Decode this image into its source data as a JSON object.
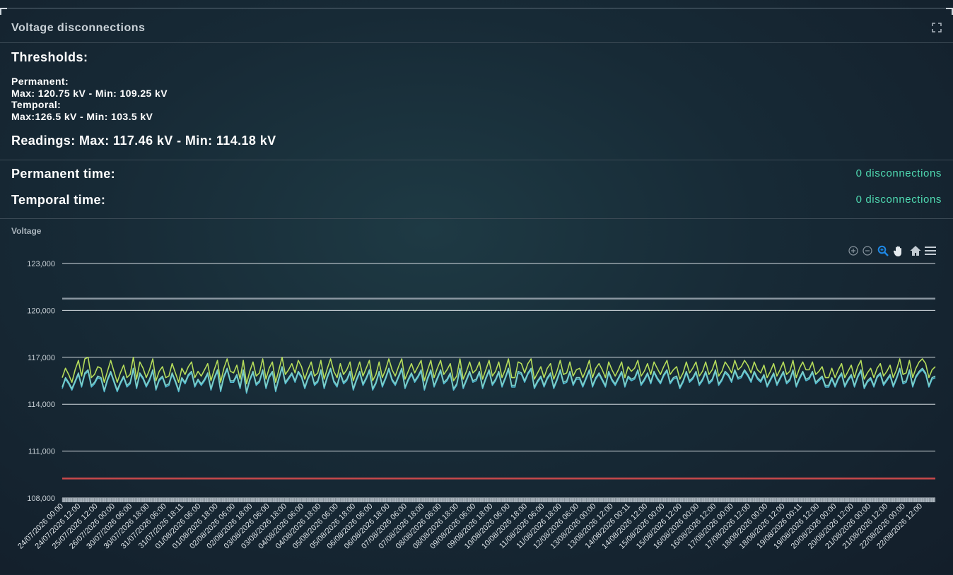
{
  "panel": {
    "title": "Voltage disconnections",
    "expand_icon": "fullscreen-icon"
  },
  "thresholds": {
    "heading": "Thresholds:",
    "permanent_label": "Permanent:",
    "permanent_range": "Max: 120.75 kV - Min: 109.25 kV",
    "temporal_label": "Temporal:",
    "temporal_range": "Max:126.5 kV - Min: 103.5 kV",
    "readings": "Readings: Max: 117.46 kV - Min: 114.18 kV"
  },
  "disconnections": {
    "permanent_label": "Permanent time:",
    "permanent_value": "0 disconnections",
    "temporal_label": "Temporal time:",
    "temporal_value": "0 disconnections"
  },
  "toolbar": [
    "zoom-in-icon",
    "zoom-out-icon",
    "selection-zoom-icon",
    "pan-hand-icon",
    "home-reset-icon",
    "menu-icon"
  ],
  "colors": {
    "accent": "#4fd8b0",
    "series_1": "#b5dc5a",
    "series_2": "#4fb8d2",
    "series_3": "#7ed0c8",
    "max_threshold": "#8a96a0",
    "min_threshold": "#c9494b"
  },
  "chart_data": {
    "type": "line",
    "title": "Voltage",
    "ylim": [
      108000,
      123000
    ],
    "yticks": [
      123000,
      120000,
      117000,
      114000,
      111000,
      108000
    ],
    "ytick_labels": [
      "123,000",
      "120,000",
      "117,000",
      "114,000",
      "111,000",
      "108,000"
    ],
    "x_tick_labels": [
      "24/07/2026 00:00",
      "24/07/2026 12:00",
      "25/07/2026 12:00",
      "26/07/2026 00:00",
      "30/07/2026 06:00",
      "30/07/2026 18:00",
      "31/07/2026 06:00",
      "31/07/2026 18:11",
      "01/08/2026 06:00",
      "01/08/2026 18:00",
      "02/08/2026 06:00",
      "02/08/2026 18:00",
      "03/08/2026 06:00",
      "03/08/2026 18:00",
      "04/08/2026 06:00",
      "04/08/2026 18:00",
      "05/08/2026 06:00",
      "05/08/2026 18:00",
      "06/08/2026 06:00",
      "06/08/2026 18:00",
      "07/08/2026 06:00",
      "07/08/2026 18:00",
      "08/08/2026 06:00",
      "08/08/2026 18:00",
      "09/08/2026 06:00",
      "09/08/2026 18:00",
      "10/08/2026 06:00",
      "10/08/2026 18:00",
      "11/08/2026 06:00",
      "11/08/2026 18:00",
      "12/08/2026 06:00",
      "13/08/2026 00:00",
      "13/08/2026 12:00",
      "14/08/2026 00:11",
      "14/08/2026 12:00",
      "15/08/2026 00:00",
      "15/08/2026 12:00",
      "16/08/2026 00:00",
      "16/08/2026 12:00",
      "17/08/2026 00:00",
      "17/08/2026 12:00",
      "18/08/2026 00:00",
      "18/08/2026 12:00",
      "19/08/2026 00:11",
      "19/08/2026 12:00",
      "20/08/2026 00:00",
      "20/08/2026 12:00",
      "21/08/2026 00:00",
      "21/08/2026 12:00",
      "22/08/2026 00:00",
      "22/08/2026 12:00"
    ],
    "thresholds": [
      {
        "value": 120750
      },
      {
        "value": 109250
      }
    ],
    "series": [
      {
        "values": [
          115700,
          116300,
          115900,
          115400,
          116200,
          116800,
          115800,
          116900,
          117000,
          115700,
          115900,
          116400,
          116300,
          115400,
          116100,
          116800,
          116100,
          115400,
          116000,
          116500,
          115700,
          115900,
          117000,
          115600,
          116700,
          116300,
          115700,
          116200,
          116900,
          115500,
          116100,
          116400,
          115700,
          115800,
          116600,
          116000,
          115400,
          116300,
          115900,
          116400,
          116700,
          115700,
          116100,
          115800,
          116200,
          116600,
          115500,
          116200,
          116800,
          115400,
          116300,
          116900,
          116100,
          116000,
          116500,
          115600,
          116800,
          115300,
          116100,
          116700,
          115800,
          116000,
          116900,
          115600,
          116300,
          116700,
          115400,
          116200,
          117000,
          115900,
          116200,
          116600,
          116000,
          116800,
          116400,
          115600,
          116200,
          116700,
          115800,
          116000,
          116800,
          115600,
          116300,
          116900,
          116100,
          115700,
          116600,
          115900,
          116200,
          116700,
          115500,
          116100,
          116700,
          115800,
          116300,
          116800,
          115500,
          115900,
          116700,
          115700,
          116200,
          116900,
          116200,
          115800,
          116400,
          116900,
          115600,
          116100,
          116600,
          116000,
          116400,
          116800,
          115500,
          116200,
          116800,
          115700,
          116300,
          116800,
          115900,
          116200,
          116600,
          115500,
          115800,
          116900,
          115600,
          116100,
          116700,
          116000,
          116200,
          116700,
          115600,
          116200,
          116800,
          115800,
          116100,
          116700,
          115700,
          116200,
          116900,
          115700,
          115700,
          116700,
          116600,
          116000,
          116600,
          116900,
          115600,
          116000,
          116400,
          115700,
          116300,
          116600,
          115600,
          116100,
          116800,
          115900,
          116000,
          116700,
          115800,
          116200,
          116300,
          115700,
          116200,
          116800,
          115700,
          116300,
          116600,
          116200,
          115700,
          116700,
          116200,
          115800,
          116200,
          116700,
          115700,
          116400,
          116100,
          116300,
          116800,
          115800,
          116100,
          116600,
          115900,
          116700,
          116300,
          115900,
          116400,
          116800,
          115900,
          116200,
          116400,
          115600,
          116000,
          116700,
          116000,
          116300,
          116700,
          115800,
          116100,
          116700,
          115900,
          116200,
          116800,
          115800,
          116100,
          116700,
          116400,
          116000,
          116800,
          116200,
          116400,
          116800,
          116500,
          116000,
          116700,
          116200,
          116000,
          116500,
          115700,
          116100,
          116600,
          115800,
          116200,
          116700,
          115900,
          116100,
          116800,
          115700,
          116300,
          116700,
          116200,
          116200,
          116700,
          115900,
          116100,
          116400,
          115700,
          115700,
          116300,
          115700,
          116200,
          116600,
          115700,
          116100,
          116500,
          115700,
          116400,
          116800,
          115600,
          116000,
          116300,
          115700,
          116300,
          116600,
          115800,
          116100,
          116500,
          115700,
          116200,
          116900,
          115900,
          116000,
          116800,
          115700,
          116300,
          116700,
          116900,
          116600,
          115700,
          116200,
          116400
        ]
      },
      {
        "values": [
          115000,
          115600,
          115300,
          114900,
          115400,
          115900,
          115100,
          115900,
          116100,
          115100,
          115300,
          115700,
          115600,
          114800,
          115500,
          116000,
          115400,
          114800,
          115300,
          115700,
          115100,
          115300,
          116200,
          115000,
          115900,
          115600,
          115100,
          115500,
          116100,
          114900,
          115500,
          115700,
          115100,
          115200,
          115900,
          115400,
          114800,
          115600,
          115300,
          115800,
          116000,
          115100,
          115500,
          115200,
          115500,
          115900,
          114900,
          115600,
          116100,
          114800,
          115700,
          116200,
          115400,
          115400,
          115800,
          115000,
          116100,
          114700,
          115500,
          116000,
          115200,
          115400,
          116100,
          115000,
          115700,
          116000,
          114800,
          115600,
          116300,
          115300,
          115600,
          115900,
          115400,
          116000,
          115700,
          115000,
          115600,
          116000,
          115200,
          115400,
          116100,
          115000,
          115700,
          116200,
          115400,
          115100,
          115900,
          115300,
          115500,
          116000,
          114900,
          115500,
          116000,
          115200,
          115600,
          116100,
          114900,
          115300,
          116000,
          115100,
          115600,
          116200,
          115500,
          115200,
          115700,
          116200,
          115000,
          115500,
          115900,
          115400,
          115700,
          116100,
          114900,
          115600,
          116100,
          115100,
          115600,
          116100,
          115300,
          115500,
          115900,
          114900,
          115200,
          116200,
          115000,
          115500,
          116000,
          115400,
          115500,
          116000,
          115000,
          115600,
          116100,
          115200,
          115500,
          116000,
          115100,
          115600,
          116200,
          115100,
          115100,
          116000,
          115900,
          115400,
          115900,
          116200,
          115000,
          115400,
          115700,
          115100,
          115600,
          115900,
          115000,
          115500,
          116100,
          115300,
          115400,
          116000,
          115200,
          115600,
          115600,
          115100,
          115600,
          116100,
          115100,
          115600,
          115900,
          115500,
          115100,
          116000,
          115500,
          115200,
          115600,
          116000,
          115100,
          115700,
          115500,
          115600,
          116100,
          115200,
          115500,
          115900,
          115300,
          116000,
          115600,
          115300,
          115800,
          116100,
          115300,
          115600,
          115700,
          115000,
          115400,
          116000,
          115400,
          115600,
          116000,
          115200,
          115500,
          116000,
          115300,
          115500,
          116100,
          115200,
          115500,
          116000,
          115800,
          115400,
          116100,
          115600,
          115700,
          116100,
          115800,
          115400,
          116000,
          115600,
          115400,
          115800,
          115100,
          115500,
          115900,
          115200,
          115600,
          116000,
          115300,
          115500,
          116100,
          115100,
          115600,
          116000,
          115500,
          115600,
          116000,
          115300,
          115500,
          115700,
          115100,
          115100,
          115600,
          115100,
          115600,
          115900,
          115100,
          115500,
          115800,
          115100,
          115700,
          116100,
          115000,
          115400,
          115600,
          115100,
          115700,
          115900,
          115200,
          115500,
          115800,
          115100,
          115600,
          116200,
          115300,
          115400,
          116100,
          115100,
          115700,
          116000,
          116200,
          115900,
          115100,
          115600,
          115700
        ]
      },
      {
        "values": [
          115100,
          115700,
          115400,
          115000,
          115500,
          116000,
          115200,
          116000,
          116200,
          115200,
          115400,
          115800,
          115700,
          114900,
          115600,
          116100,
          115500,
          114900,
          115400,
          115800,
          115200,
          115400,
          116300,
          115100,
          116000,
          115700,
          115200,
          115600,
          116200,
          115000,
          115600,
          115800,
          115200,
          115300,
          116000,
          115500,
          114900,
          115700,
          115400,
          115900,
          116100,
          115200,
          115600,
          115300,
          115600,
          116000,
          115000,
          115700,
          116200,
          114900,
          115800,
          116300,
          115500,
          115500,
          115900,
          115100,
          116200,
          114800,
          115600,
          116100,
          115300,
          115500,
          116200,
          115100,
          115800,
          116100,
          114900,
          115700,
          116400,
          115400,
          115700,
          116000,
          115500,
          116100,
          115800,
          115100,
          115700,
          116100,
          115300,
          115500,
          116200,
          115100,
          115800,
          116300,
          115500,
          115200,
          116000,
          115400,
          115600,
          116100,
          115000,
          115600,
          116100,
          115300,
          115700,
          116200,
          115000,
          115400,
          116100,
          115200,
          115700,
          116300,
          115600,
          115300,
          115800,
          116300,
          115100,
          115600,
          116000,
          115500,
          115800,
          116200,
          115000,
          115700,
          116200,
          115200,
          115700,
          116200,
          115400,
          115600,
          116000,
          115000,
          115300,
          116300,
          115100,
          115600,
          116100,
          115500,
          115600,
          116100,
          115100,
          115700,
          116200,
          115300,
          115600,
          116100,
          115200,
          115700,
          116300,
          115200,
          115200,
          116100,
          116000,
          115500,
          116000,
          116300,
          115100,
          115500,
          115800,
          115200,
          115700,
          116000,
          115100,
          115600,
          116200,
          115400,
          115500,
          116100,
          115300,
          115700,
          115700,
          115200,
          115700,
          116200,
          115200,
          115700,
          116000,
          115600,
          115200,
          116100,
          115600,
          115300,
          115700,
          116100,
          115200,
          115800,
          115600,
          115700,
          116200,
          115300,
          115600,
          116000,
          115400,
          116100,
          115700,
          115400,
          115900,
          116200,
          115400,
          115700,
          115800,
          115100,
          115500,
          116100,
          115500,
          115700,
          116100,
          115300,
          115600,
          116100,
          115400,
          115600,
          116200,
          115300,
          115600,
          116100,
          115900,
          115500,
          116200,
          115700,
          115800,
          116200,
          115900,
          115500,
          116100,
          115700,
          115500,
          115900,
          115200,
          115600,
          116000,
          115300,
          115700,
          116100,
          115400,
          115600,
          116200,
          115200,
          115700,
          116100,
          115600,
          115700,
          116100,
          115400,
          115600,
          115800,
          115200,
          115200,
          115700,
          115200,
          115700,
          116000,
          115200,
          115600,
          115900,
          115200,
          115800,
          116200,
          115100,
          115500,
          115700,
          115200,
          115800,
          116000,
          115300,
          115600,
          115900,
          115200,
          115700,
          116300,
          115400,
          115500,
          116200,
          115200,
          115800,
          116100,
          116300,
          116000,
          115200,
          115700,
          115800
        ]
      }
    ]
  }
}
